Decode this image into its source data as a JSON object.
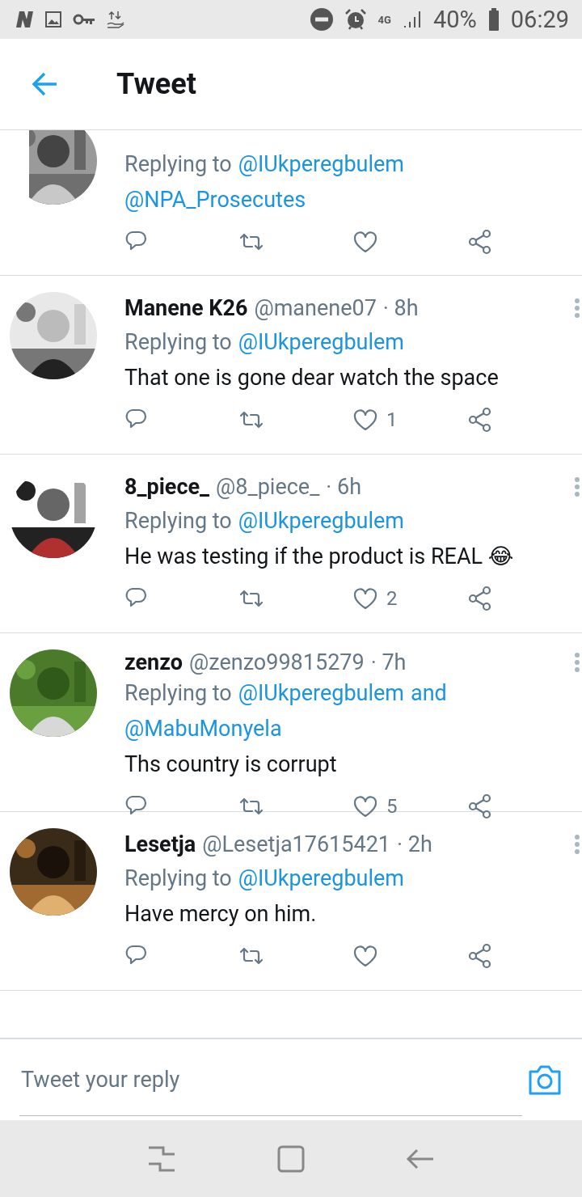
{
  "status_bar": {
    "network": "4G",
    "battery": "40%",
    "time": "06:29"
  },
  "header": {
    "title": "Tweet"
  },
  "tweets": [
    {
      "kind": "partial",
      "replying_label": "Replying to",
      "mentions": [
        "@IUkperegbulem",
        "@NPA_Prosecutes"
      ]
    },
    {
      "kind": "full",
      "name": "Manene K26",
      "handle": "@manene07",
      "time": "· 8h",
      "replying_label": "Replying to",
      "mentions": [
        "@IUkperegbulem"
      ],
      "text": "That one is gone dear watch the space",
      "like_count": "1"
    },
    {
      "kind": "full",
      "name": "8_piece_",
      "handle": "@8_piece_",
      "time": "· 6h",
      "replying_label": "Replying to",
      "mentions": [
        "@IUkperegbulem"
      ],
      "text": "He was testing if the product is REAL 😂",
      "like_count": "2"
    },
    {
      "kind": "full",
      "name": "zenzo",
      "handle": "@zenzo99815279",
      "time": "· 7h",
      "replying_label": "Replying to",
      "mentions": [
        "@IUkperegbulem",
        "and",
        "@MabuMonyela"
      ],
      "text": "Ths country is corrupt",
      "like_count": "5"
    },
    {
      "kind": "full",
      "name": "Lesetja",
      "handle": "@Lesetja17615421",
      "time": "· 2h",
      "replying_label": "Replying to",
      "mentions": [
        "@IUkperegbulem"
      ],
      "text": "Have mercy on him."
    }
  ],
  "reply_bar": {
    "placeholder": "Tweet your reply"
  }
}
